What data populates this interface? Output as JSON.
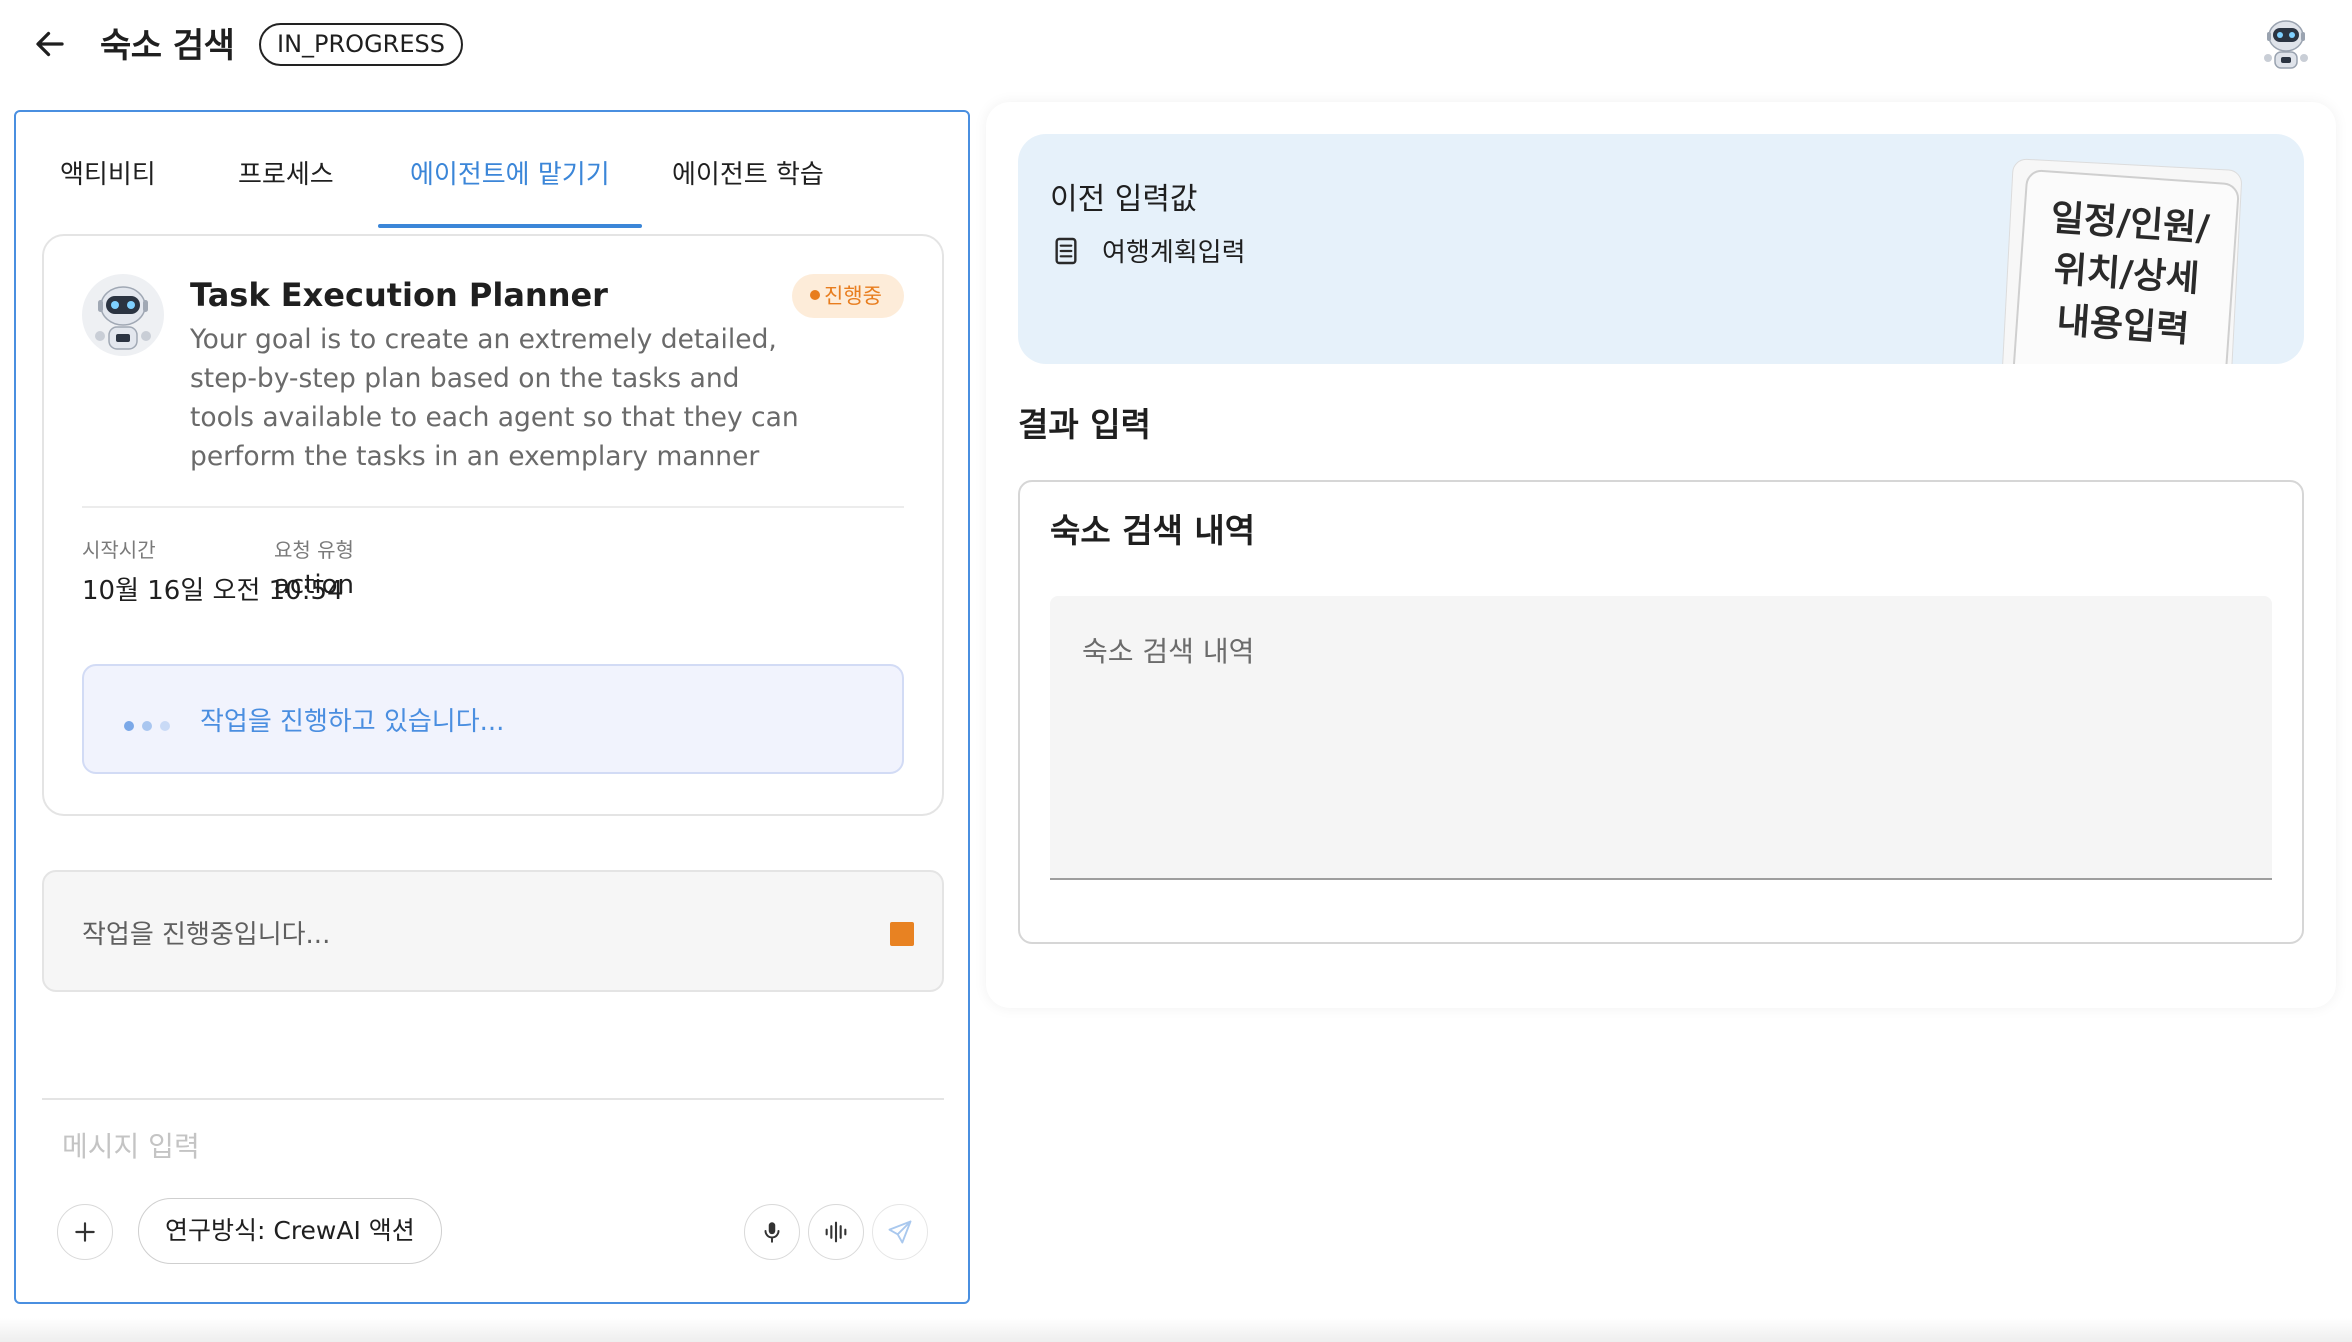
{
  "header": {
    "title": "숙소 검색",
    "status": "IN_PROGRESS"
  },
  "tabs": [
    {
      "label": "액티비티",
      "active": false
    },
    {
      "label": "프로세스",
      "active": false
    },
    {
      "label": "에이전트에 맡기기",
      "active": true
    },
    {
      "label": "에이전트 학습",
      "active": false
    }
  ],
  "task_card": {
    "title": "Task Execution Planner",
    "badge": "진행중",
    "description": "Your goal is to create an extremely detailed, step-by-step plan based on the tasks and tools available to each agent so that they can perform the tasks in an exemplary manner",
    "start_time_label": "시작시간",
    "start_time_value": "10월 16일 오전 10:54",
    "request_type_label": "요청 유형",
    "request_type_value": "action",
    "working_text": "작업을 진행하고 있습니다..."
  },
  "running_status": "작업을 진행중입니다...",
  "composer": {
    "placeholder": "메시지 입력",
    "mode_chip": "연구방식: CrewAI 액션"
  },
  "previous_input": {
    "title": "이전 입력값",
    "item": "여행계획입력",
    "note": "일정/인원/위치/상세내용입력"
  },
  "result": {
    "heading": "결과 입력",
    "card_title": "숙소 검색 내역",
    "placeholder": "숙소 검색 내역"
  },
  "colors": {
    "accent": "#3b86d8",
    "badge_text": "#e87d1e",
    "badge_bg": "#fdecd9",
    "prev_input_bg": "#e6f1fa"
  },
  "icons": {
    "back": "arrow-left-icon",
    "add": "plus-icon",
    "mic": "microphone-icon",
    "voice": "waveform-icon",
    "send": "paper-plane-icon",
    "document": "document-list-icon"
  }
}
